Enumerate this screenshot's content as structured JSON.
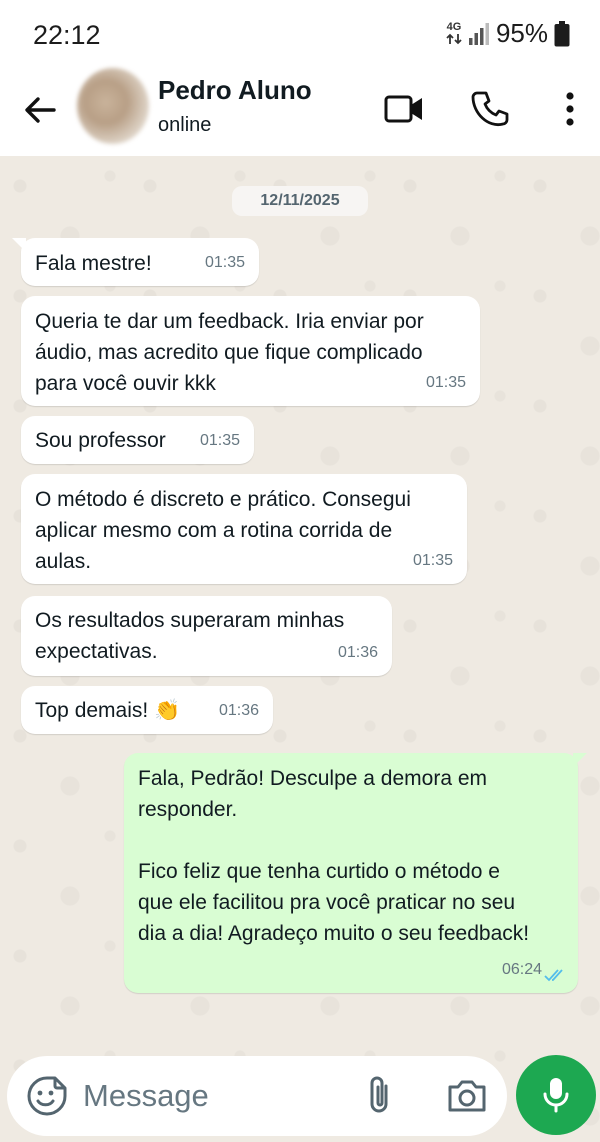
{
  "status_bar": {
    "time": "22:12",
    "network_top": "4G",
    "battery": "95%"
  },
  "header": {
    "contact_name": "Pedro Aluno",
    "contact_status": "online",
    "icons": [
      "back-arrow-icon",
      "video-call-icon",
      "voice-call-icon",
      "more-options-icon"
    ]
  },
  "chat": {
    "date_chip": "12/11/2025",
    "messages": [
      {
        "direction": "in",
        "text": "Fala mestre!",
        "time": "01:35"
      },
      {
        "direction": "in",
        "text": "Queria te dar um feedback. Iria enviar por\náudio, mas acredito que fique complicado\npara você ouvir kkk",
        "time": "01:35"
      },
      {
        "direction": "in",
        "text": "Sou professor",
        "time": "01:35"
      },
      {
        "direction": "in",
        "text": "O método é discreto e prático. Consegui\naplicar mesmo com a rotina corrida de\naulas.",
        "time": "01:35"
      },
      {
        "direction": "in",
        "text": "Os resultados superaram minhas\nexpectativas.",
        "time": "01:36"
      },
      {
        "direction": "in",
        "text": "Top demais! 👏",
        "time": "01:36"
      },
      {
        "direction": "out",
        "text": "Fala, Pedrão! Desculpe a demora em\nresponder.\n\nFico feliz que tenha curtido o método e\nque ele facilitou pra você praticar no seu\ndia a dia! Agradeço muito o seu feedback!",
        "time": "06:24",
        "read": true
      }
    ]
  },
  "composer": {
    "placeholder": "Message",
    "icons": [
      "emoji-sticker-icon",
      "attach-icon",
      "camera-icon",
      "microphone-icon"
    ]
  },
  "colors": {
    "chat_background": "#efeae2",
    "incoming_bubble": "#ffffff",
    "outgoing_bubble": "#d9fdd3",
    "mic_button": "#1da851",
    "read_ticks": "#53bdeb"
  }
}
